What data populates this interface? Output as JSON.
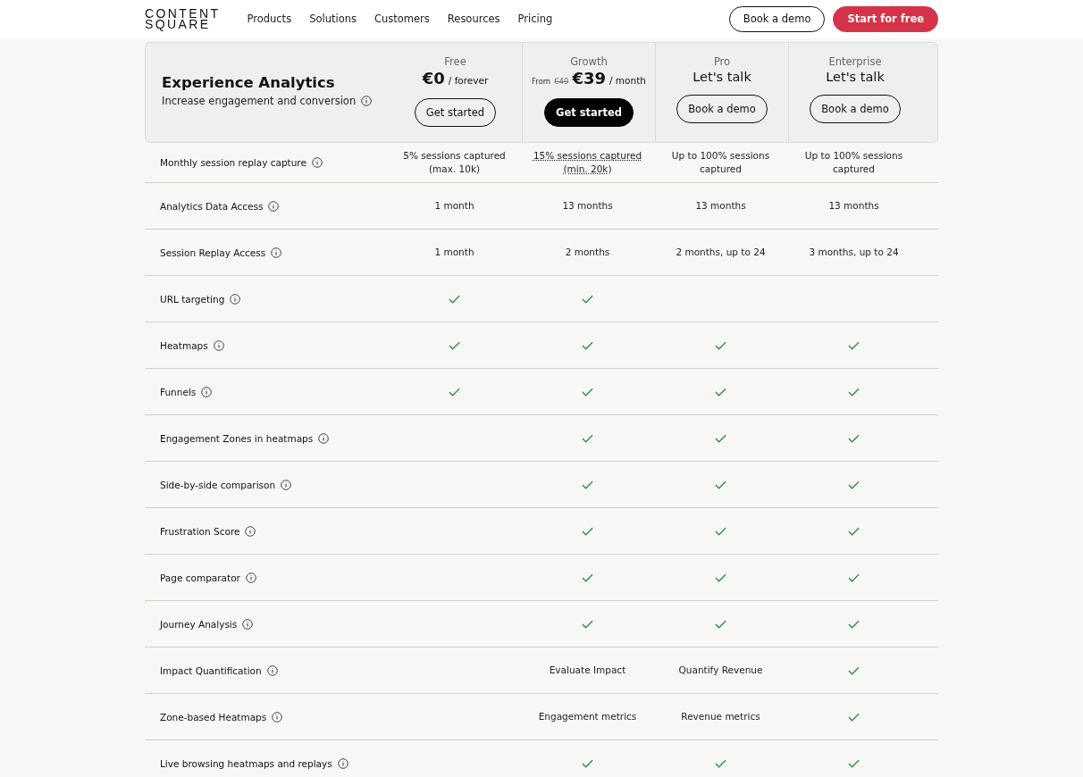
{
  "nav": {
    "logo": [
      "CONTENT",
      "SQUARE"
    ],
    "links": [
      "Products",
      "Solutions",
      "Customers",
      "Resources",
      "Pricing"
    ],
    "buttons": [
      {
        "label": "Book a demo",
        "primary": false
      },
      {
        "label": "Start for free",
        "primary": true
      }
    ]
  },
  "header": {
    "title": "Experience Analytics",
    "subtitle": "Increase engagement and conversion",
    "plans": [
      {
        "name": "Free",
        "kind": "price",
        "price": "€0",
        "period": "/ forever",
        "button": {
          "label": "Get started",
          "primary": false
        }
      },
      {
        "name": "Growth",
        "kind": "price",
        "from": "From",
        "old_price": "€49",
        "price": "€39",
        "period": "/ month",
        "button": {
          "label": "Get started",
          "primary": true
        }
      },
      {
        "name": "Pro",
        "kind": "talk",
        "price": "Let's talk",
        "button": {
          "label": "Book a demo",
          "primary": false
        }
      },
      {
        "name": "Enterprise",
        "kind": "talk",
        "price": "Let's talk",
        "button": {
          "label": "Book a demo",
          "primary": false
        }
      }
    ]
  },
  "rows": [
    {
      "label": "Monthly session replay capture",
      "cells": [
        {
          "kind": "text",
          "text": "5% sessions captured (max. 10k)"
        },
        {
          "kind": "dotted",
          "text": "15% sessions captured (min. 20k)"
        },
        {
          "kind": "text",
          "text": "Up to 100% sessions captured"
        },
        {
          "kind": "text",
          "text": "Up to 100% sessions captured"
        }
      ]
    },
    {
      "label": "Analytics Data Access",
      "cells": [
        {
          "kind": "text",
          "text": "1 month"
        },
        {
          "kind": "text",
          "text": "13 months"
        },
        {
          "kind": "text",
          "text": "13 months"
        },
        {
          "kind": "text",
          "text": "13 months"
        }
      ]
    },
    {
      "label": "Session Replay Access",
      "cells": [
        {
          "kind": "text",
          "text": "1 month"
        },
        {
          "kind": "text",
          "text": "2 months"
        },
        {
          "kind": "text",
          "text": "2 months, up to 24"
        },
        {
          "kind": "text",
          "text": "3 months, up to 24"
        }
      ]
    },
    {
      "label": "URL targeting",
      "cells": [
        {
          "kind": "check"
        },
        {
          "kind": "check"
        },
        {
          "kind": "none"
        },
        {
          "kind": "none"
        }
      ]
    },
    {
      "label": "Heatmaps",
      "cells": [
        {
          "kind": "check"
        },
        {
          "kind": "check"
        },
        {
          "kind": "check"
        },
        {
          "kind": "check"
        }
      ]
    },
    {
      "label": "Funnels",
      "cells": [
        {
          "kind": "check"
        },
        {
          "kind": "check"
        },
        {
          "kind": "check"
        },
        {
          "kind": "check"
        }
      ]
    },
    {
      "label": "Engagement Zones in heatmaps",
      "cells": [
        {
          "kind": "none"
        },
        {
          "kind": "check"
        },
        {
          "kind": "check"
        },
        {
          "kind": "check"
        }
      ]
    },
    {
      "label": "Side-by-side comparison",
      "cells": [
        {
          "kind": "none"
        },
        {
          "kind": "check"
        },
        {
          "kind": "check"
        },
        {
          "kind": "check"
        }
      ]
    },
    {
      "label": "Frustration Score",
      "cells": [
        {
          "kind": "none"
        },
        {
          "kind": "check"
        },
        {
          "kind": "check"
        },
        {
          "kind": "check"
        }
      ]
    },
    {
      "label": "Page comparator",
      "cells": [
        {
          "kind": "none"
        },
        {
          "kind": "check"
        },
        {
          "kind": "check"
        },
        {
          "kind": "check"
        }
      ]
    },
    {
      "label": "Journey Analysis",
      "cells": [
        {
          "kind": "none"
        },
        {
          "kind": "check"
        },
        {
          "kind": "check"
        },
        {
          "kind": "check"
        }
      ]
    },
    {
      "label": "Impact Quantification",
      "cells": [
        {
          "kind": "none"
        },
        {
          "kind": "text",
          "text": "Evaluate Impact"
        },
        {
          "kind": "text",
          "text": "Quantify Revenue"
        },
        {
          "kind": "check"
        }
      ]
    },
    {
      "label": "Zone-based Heatmaps",
      "cells": [
        {
          "kind": "none"
        },
        {
          "kind": "text",
          "text": "Engagement metrics"
        },
        {
          "kind": "text",
          "text": "Revenue metrics"
        },
        {
          "kind": "check"
        }
      ]
    },
    {
      "label": "Live browsing heatmaps and replays",
      "cells": [
        {
          "kind": "none"
        },
        {
          "kind": "check"
        },
        {
          "kind": "check"
        },
        {
          "kind": "check"
        }
      ]
    }
  ]
}
